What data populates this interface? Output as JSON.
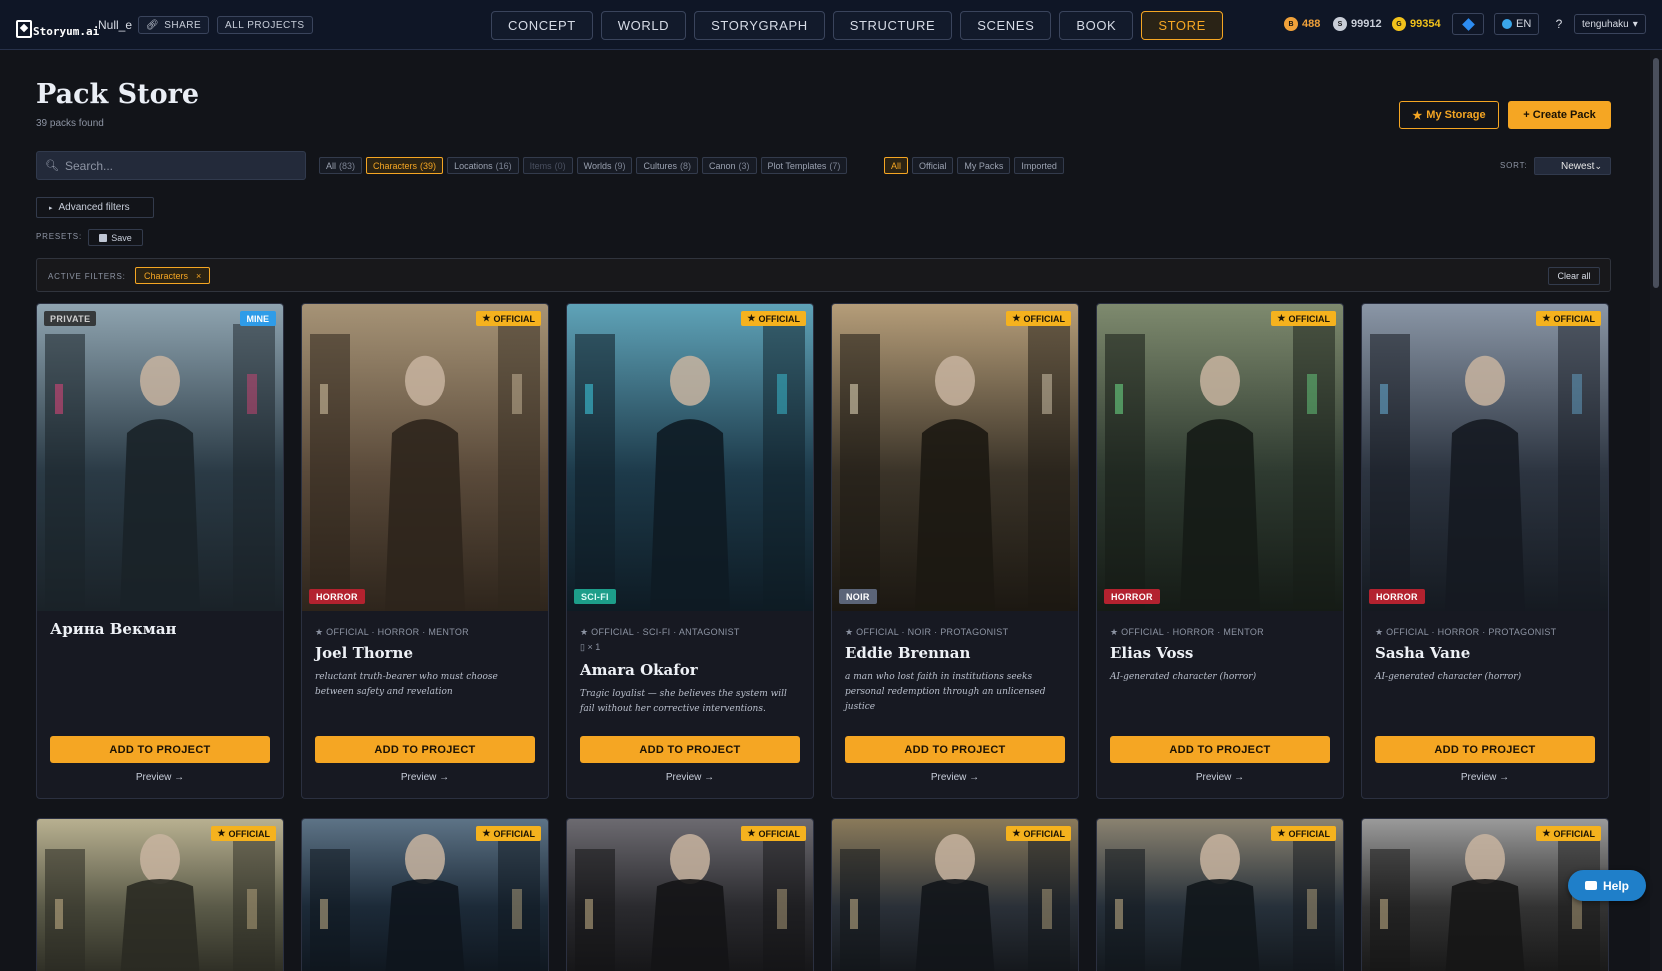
{
  "header": {
    "logo_text": "Storyum.ai",
    "username": "Null_e",
    "share_label": "SHARE",
    "all_projects_label": "ALL PROJECTS",
    "nav_tabs": [
      {
        "label": "CONCEPT",
        "active": false
      },
      {
        "label": "WORLD",
        "active": false
      },
      {
        "label": "STORYGRAPH",
        "active": false
      },
      {
        "label": "STRUCTURE",
        "active": false
      },
      {
        "label": "SCENES",
        "active": false
      },
      {
        "label": "BOOK",
        "active": false
      },
      {
        "label": "STORE",
        "active": true
      }
    ],
    "currencies": [
      {
        "icon": "B",
        "value": "488",
        "color": "#f0a13a"
      },
      {
        "icon": "S",
        "value": "99912",
        "color": "#c9ced8"
      },
      {
        "icon": "G",
        "value": "99354",
        "color": "#f2c21b"
      }
    ],
    "language": "EN",
    "help_symbol": "?",
    "account": "tenguhaku"
  },
  "store": {
    "title": "Pack Store",
    "count_text": "39 packs found",
    "my_storage_label": "My Storage",
    "create_pack_label": "+ Create Pack",
    "search_placeholder": "Search...",
    "categories": [
      {
        "label": "All",
        "count": "(83)",
        "state": "normal"
      },
      {
        "label": "Characters",
        "count": "(39)",
        "state": "active"
      },
      {
        "label": "Locations",
        "count": "(16)",
        "state": "normal"
      },
      {
        "label": "Items",
        "count": "(0)",
        "state": "disabled"
      },
      {
        "label": "Worlds",
        "count": "(9)",
        "state": "normal"
      },
      {
        "label": "Cultures",
        "count": "(8)",
        "state": "normal"
      },
      {
        "label": "Canon",
        "count": "(3)",
        "state": "normal"
      },
      {
        "label": "Plot Templates",
        "count": "(7)",
        "state": "normal"
      }
    ],
    "owners": [
      {
        "label": "All",
        "state": "active"
      },
      {
        "label": "Official",
        "state": "normal"
      },
      {
        "label": "My Packs",
        "state": "normal"
      },
      {
        "label": "Imported",
        "state": "normal"
      }
    ],
    "sort_label": "SORT:",
    "sort_value": "Newest",
    "advanced_filters_label": "Advanced filters",
    "presets_label": "PRESETS:",
    "save_label": "Save",
    "active_filters_label": "ACTIVE FILTERS:",
    "active_filter": "Characters",
    "active_filter_remove": "×",
    "clear_all_label": "Clear all"
  },
  "cards": [
    {
      "name": "Арина Векман",
      "private_badge": "PRIVATE",
      "mine_badge": "MINE",
      "official_badge": "",
      "genre": "",
      "genre_class": "",
      "meta": "",
      "meta_sub": "",
      "description": "",
      "palette": [
        "#2a3a45",
        "#8fa4b0",
        "#1a2228"
      ],
      "accent": "#e0457b"
    },
    {
      "name": "Joel Thorne",
      "private_badge": "",
      "mine_badge": "",
      "official_badge": "OFFICIAL",
      "genre": "HORROR",
      "genre_class": "horror",
      "meta": "★ OFFICIAL · HORROR · MENTOR",
      "meta_sub": "",
      "description": "reluctant truth-bearer who must choose between safety and revelation",
      "palette": [
        "#5a4a3a",
        "#a69376",
        "#2e251c"
      ],
      "accent": "#d9c8a8"
    },
    {
      "name": "Amara Okafor",
      "private_badge": "",
      "mine_badge": "",
      "official_badge": "OFFICIAL",
      "genre": "SCI-FI",
      "genre_class": "scifi",
      "meta": "★ OFFICIAL · SCI-FI · ANTAGONIST",
      "meta_sub": "▯ × 1",
      "description": "Tragic loyalist — she believes the system will fail without her corrective interventions.",
      "palette": [
        "#1d3a4a",
        "#5fa3b8",
        "#0e1b24"
      ],
      "accent": "#3fd0e6"
    },
    {
      "name": "Eddie Brennan",
      "private_badge": "",
      "mine_badge": "",
      "official_badge": "OFFICIAL",
      "genre": "NOIR",
      "genre_class": "noir",
      "meta": "★ OFFICIAL · NOIR · PROTAGONIST",
      "meta_sub": "",
      "description": "a man who lost faith in institutions seeks personal redemption through an unlicensed justice",
      "palette": [
        "#3a3328",
        "#b59d79",
        "#1c1812"
      ],
      "accent": "#e8dcc0"
    },
    {
      "name": "Elias Voss",
      "private_badge": "",
      "mine_badge": "",
      "official_badge": "OFFICIAL",
      "genre": "HORROR",
      "genre_class": "horror",
      "meta": "★ OFFICIAL · HORROR · MENTOR",
      "meta_sub": "",
      "description": "AI-generated character (horror)",
      "palette": [
        "#2e3a30",
        "#7e8a6e",
        "#151b16"
      ],
      "accent": "#6fe08a"
    },
    {
      "name": "Sasha Vane",
      "private_badge": "",
      "mine_badge": "",
      "official_badge": "OFFICIAL",
      "genre": "HORROR",
      "genre_class": "horror",
      "meta": "★ OFFICIAL · HORROR · PROTAGONIST",
      "meta_sub": "",
      "description": "AI-generated character (horror)",
      "palette": [
        "#2c3440",
        "#8a96a6",
        "#151a21"
      ],
      "accent": "#6ab0d8"
    }
  ],
  "cards_row2": [
    {
      "official_badge": "OFFICIAL",
      "palette": [
        "#5a5a48",
        "#b8b090",
        "#2a2a22"
      ]
    },
    {
      "official_badge": "OFFICIAL",
      "palette": [
        "#1c2a38",
        "#5d7386",
        "#0e151d"
      ]
    },
    {
      "official_badge": "OFFICIAL",
      "palette": [
        "#2a2a2e",
        "#6c6a70",
        "#141416"
      ]
    },
    {
      "official_badge": "OFFICIAL",
      "palette": [
        "#2a3038",
        "#8a7a5a",
        "#121519"
      ]
    },
    {
      "official_badge": "OFFICIAL",
      "palette": [
        "#26303a",
        "#8a8270",
        "#11161b"
      ]
    },
    {
      "official_badge": "OFFICIAL",
      "palette": [
        "#333333",
        "#9a9a9a",
        "#161616"
      ]
    }
  ],
  "card_actions": {
    "add_label": "ADD TO PROJECT",
    "preview_label": "Preview →"
  },
  "help_label": "Help",
  "colors": {
    "accent": "#f5a623",
    "background": "#121419",
    "header_bg": "#0f1626"
  }
}
